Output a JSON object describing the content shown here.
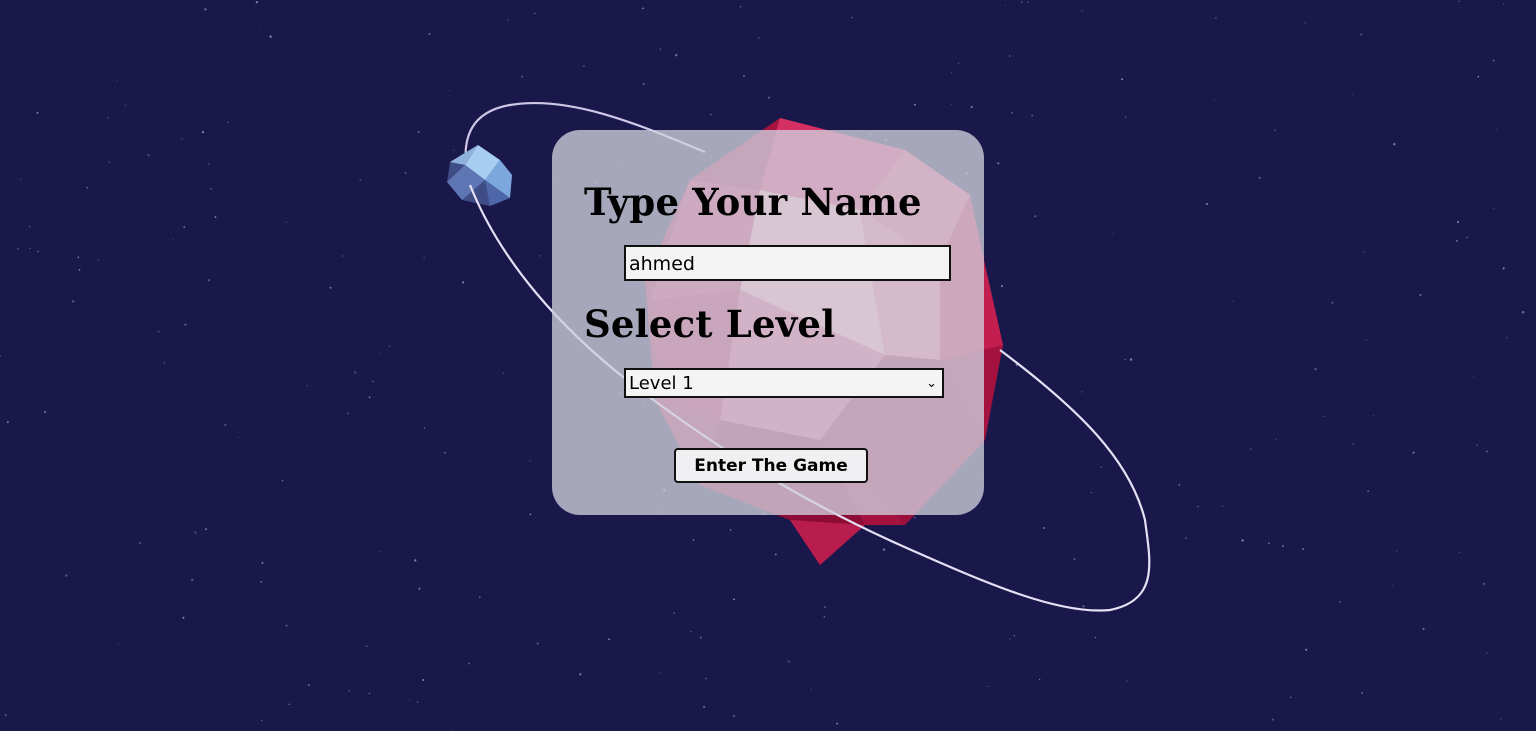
{
  "form": {
    "name_heading": "Type Your Name",
    "name_value": "ahmed",
    "level_heading": "Select Level",
    "level_selected": "Level 1",
    "enter_button": "Enter The Game"
  },
  "scene": {
    "background_color": "#1a174b",
    "planet_color": "#c0184a",
    "moon_color": "#8fb3e0",
    "orbit_color": "#cfc8e6"
  }
}
